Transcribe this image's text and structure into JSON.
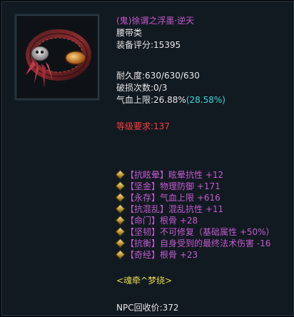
{
  "item": {
    "name": "(鬼)徐谓之浮墨·逆天",
    "type": "腰带类",
    "score_label": "装备评分:",
    "score_value": "15395",
    "durability_label": "耐久度:",
    "durability_value": "630/630/630",
    "break_label": "破损次数:",
    "break_value": "0/3",
    "hp_label": "气血上限:",
    "hp_value": "26.88%",
    "hp_bonus": "(28.58%)",
    "level_req_label": "等级要求:",
    "level_req_value": "137"
  },
  "stats": [
    {
      "tag": "【抗眩晕】",
      "text": "眩晕抗性 +12"
    },
    {
      "tag": "【坚金】",
      "text": "物理防御 +171"
    },
    {
      "tag": "【永存】",
      "text": "气血上限 +616"
    },
    {
      "tag": "【抗混乱】",
      "text": "混乱抗性 +11"
    },
    {
      "tag": "【命门】",
      "text": "根骨 +28"
    },
    {
      "tag": "【坚韧】",
      "text": "不可修复（基础属性 +50%）"
    },
    {
      "tag": "【抗衡】",
      "text": "自身受到的最终法术伤害 -16"
    },
    {
      "tag": "【奇经】",
      "text": "根骨 +23"
    }
  ],
  "set_name": "<魂牵^梦绕>",
  "npc_price_label": "NPC回收价:",
  "npc_price_value": "372",
  "colors": {
    "name": "#c45ad0",
    "hp_bonus": "#3fd6d6",
    "level_req": "#ff3a3a",
    "stats": "#c25ad0",
    "set_name": "#e6d94a"
  },
  "icon": "belt-icon"
}
